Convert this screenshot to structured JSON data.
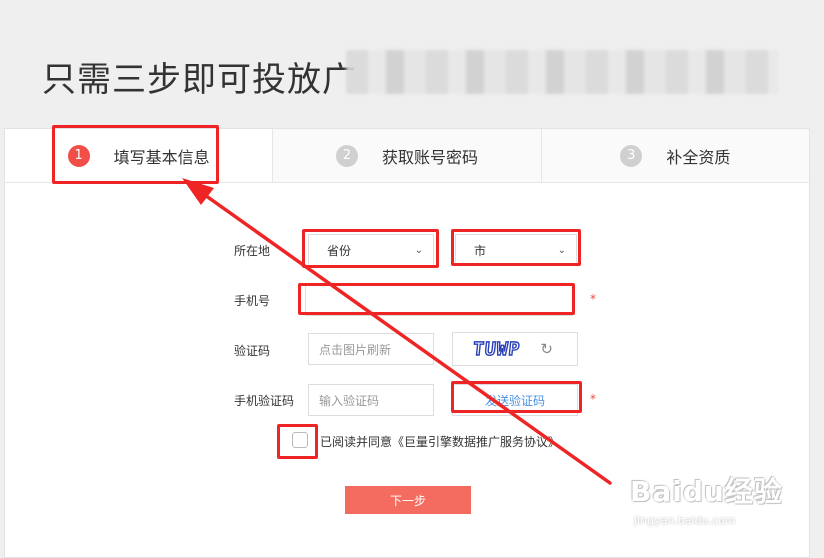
{
  "page": {
    "headline": "只需三步即可投放广"
  },
  "steps": [
    {
      "num": "1",
      "label": "填写基本信息"
    },
    {
      "num": "2",
      "label": "获取账号密码"
    },
    {
      "num": "3",
      "label": "补全资质"
    }
  ],
  "form": {
    "location_label": "所在地",
    "province_value": "省份",
    "city_value": "市",
    "phone_label": "手机号",
    "phone_value": "",
    "captcha_label": "验证码",
    "captcha_placeholder": "点击图片刷新",
    "captcha_code": "TUWP",
    "sms_label": "手机验证码",
    "sms_placeholder": "输入验证码",
    "send_code_label": "发送验证码",
    "required_mark": "*",
    "agree_prefix": "已阅读并同意",
    "agree_link": "《巨量引擎数据推广服务协议》",
    "next_label": "下一步"
  },
  "watermark": {
    "brand": "Baidu经验",
    "url": "jingyan.baidu.com"
  },
  "colors": {
    "accent": "#f04e46",
    "highlight": "#ef2525",
    "button": "#f46c5f",
    "link": "#4a90e2"
  }
}
